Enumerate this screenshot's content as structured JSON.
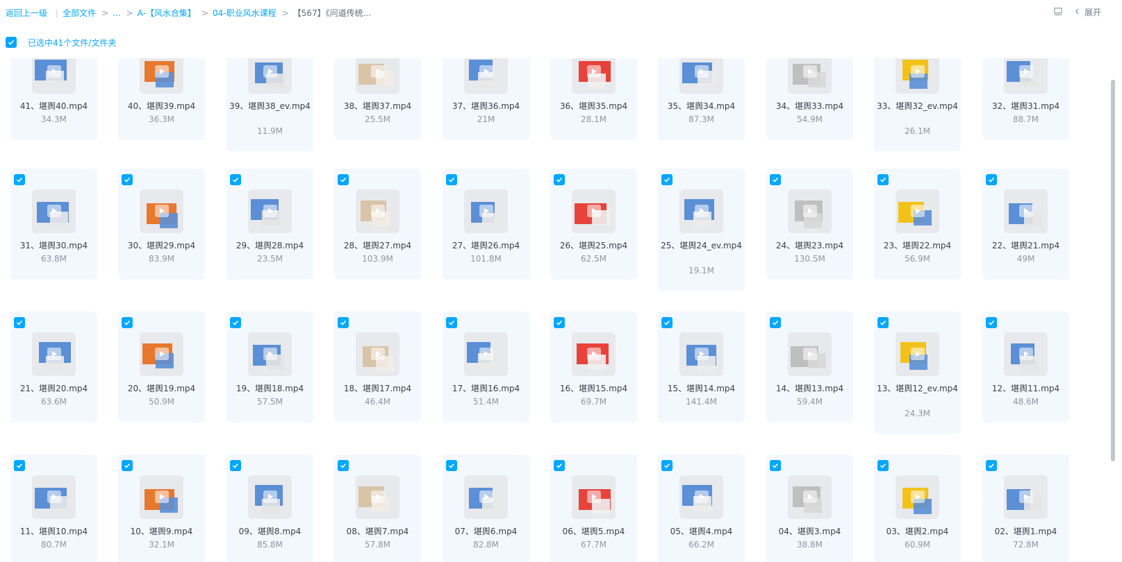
{
  "breadcrumb": {
    "back": "返回上一级",
    "items": [
      "全部文件",
      "...",
      "A-【风水合集】",
      "04-职业风水课程",
      "【567】《问道传统..."
    ]
  },
  "toolbar": {
    "expand_label": "展开"
  },
  "selection": {
    "text": "已选中41个文件/文件夹"
  },
  "colors": {
    "accent": "#06a7ff",
    "card_bg": "#f3f8ff"
  },
  "files": [
    {
      "name": "41、堪舆40.mp4",
      "size": "34.3M",
      "checked": false
    },
    {
      "name": "40、堪舆39.mp4",
      "size": "36.3M",
      "checked": false
    },
    {
      "name": "39、堪舆38_ev.mp4",
      "size": "11.9M",
      "checked": false
    },
    {
      "name": "38、堪舆37.mp4",
      "size": "25.5M",
      "checked": false
    },
    {
      "name": "37、堪舆36.mp4",
      "size": "21M",
      "checked": false
    },
    {
      "name": "36、堪舆35.mp4",
      "size": "28.1M",
      "checked": false
    },
    {
      "name": "35、堪舆34.mp4",
      "size": "87.3M",
      "checked": false
    },
    {
      "name": "34、堪舆33.mp4",
      "size": "54.9M",
      "checked": false
    },
    {
      "name": "33、堪舆32_ev.mp4",
      "size": "26.1M",
      "checked": false
    },
    {
      "name": "32、堪舆31.mp4",
      "size": "88.7M",
      "checked": false
    },
    {
      "name": "31、堪舆30.mp4",
      "size": "63.8M",
      "checked": true
    },
    {
      "name": "30、堪舆29.mp4",
      "size": "83.9M",
      "checked": true
    },
    {
      "name": "29、堪舆28.mp4",
      "size": "23.5M",
      "checked": true
    },
    {
      "name": "28、堪舆27.mp4",
      "size": "103.9M",
      "checked": true
    },
    {
      "name": "27、堪舆26.mp4",
      "size": "101.8M",
      "checked": true
    },
    {
      "name": "26、堪舆25.mp4",
      "size": "62.5M",
      "checked": true
    },
    {
      "name": "25、堪舆24_ev.mp4",
      "size": "19.1M",
      "checked": true
    },
    {
      "name": "24、堪舆23.mp4",
      "size": "130.5M",
      "checked": true
    },
    {
      "name": "23、堪舆22.mp4",
      "size": "56.9M",
      "checked": true
    },
    {
      "name": "22、堪舆21.mp4",
      "size": "49M",
      "checked": true
    },
    {
      "name": "21、堪舆20.mp4",
      "size": "63.6M",
      "checked": true
    },
    {
      "name": "20、堪舆19.mp4",
      "size": "50.9M",
      "checked": true
    },
    {
      "name": "19、堪舆18.mp4",
      "size": "57.5M",
      "checked": true
    },
    {
      "name": "18、堪舆17.mp4",
      "size": "46.4M",
      "checked": true
    },
    {
      "name": "17、堪舆16.mp4",
      "size": "51.4M",
      "checked": true
    },
    {
      "name": "16、堪舆15.mp4",
      "size": "69.7M",
      "checked": true
    },
    {
      "name": "15、堪舆14.mp4",
      "size": "141.4M",
      "checked": true
    },
    {
      "name": "14、堪舆13.mp4",
      "size": "59.4M",
      "checked": true
    },
    {
      "name": "13、堪舆12_ev.mp4",
      "size": "24.3M",
      "checked": true
    },
    {
      "name": "12、堪舆11.mp4",
      "size": "48.6M",
      "checked": true
    },
    {
      "name": "11、堪舆10.mp4",
      "size": "80.7M",
      "checked": true
    },
    {
      "name": "10、堪舆9.mp4",
      "size": "32.1M",
      "checked": true
    },
    {
      "name": "09、堪舆8.mp4",
      "size": "85.8M",
      "checked": true
    },
    {
      "name": "08、堪舆7.mp4",
      "size": "57.8M",
      "checked": true
    },
    {
      "name": "07、堪舆6.mp4",
      "size": "82.8M",
      "checked": true
    },
    {
      "name": "06、堪舆5.mp4",
      "size": "67.7M",
      "checked": true
    },
    {
      "name": "05、堪舆4.mp4",
      "size": "66.2M",
      "checked": true
    },
    {
      "name": "04、堪舆3.mp4",
      "size": "38.8M",
      "checked": true
    },
    {
      "name": "03、堪舆2.mp4",
      "size": "60.9M",
      "checked": true
    },
    {
      "name": "02、堪舆1.mp4",
      "size": "72.8M",
      "checked": true
    }
  ]
}
